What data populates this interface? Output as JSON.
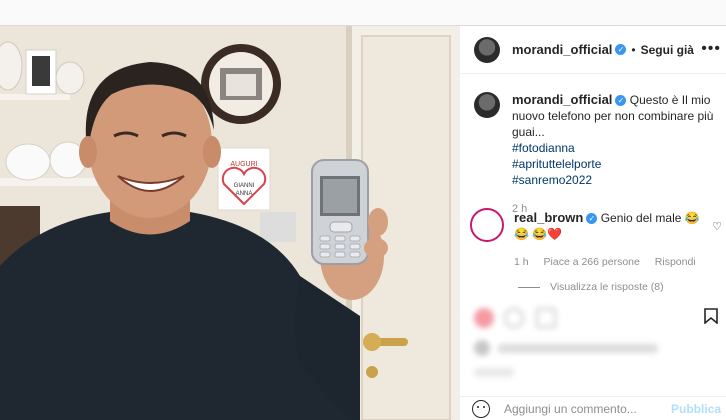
{
  "post": {
    "username": "morandi_official",
    "follow_status": "Segui già",
    "more_label": "•••"
  },
  "caption": {
    "username": "morandi_official",
    "text": "Questo è Il mio nuovo telefono per non combinare più guai...",
    "hashtags": [
      "#fotodianna",
      "#aprituttelelporte",
      "#sanremo2022"
    ],
    "time": "2 h"
  },
  "comment": {
    "username": "real_brown",
    "text": "Genio del male 😂😂 😂❤️",
    "time": "1 h",
    "likes": "Piace a 266 persone",
    "reply": "Rispondi",
    "view_replies": "Visualizza le risposte (8)"
  },
  "add_comment": {
    "placeholder": "Aggiungi un commento...",
    "publish": "Pubblica"
  },
  "photo": {
    "sign_text": [
      "AUGURI",
      "GIANNI",
      "ANNA"
    ]
  },
  "colors": {
    "accent": "#3897f0",
    "hashtag": "#00376b",
    "muted": "#8e8e8e",
    "publish_disabled": "#b2dffc"
  }
}
